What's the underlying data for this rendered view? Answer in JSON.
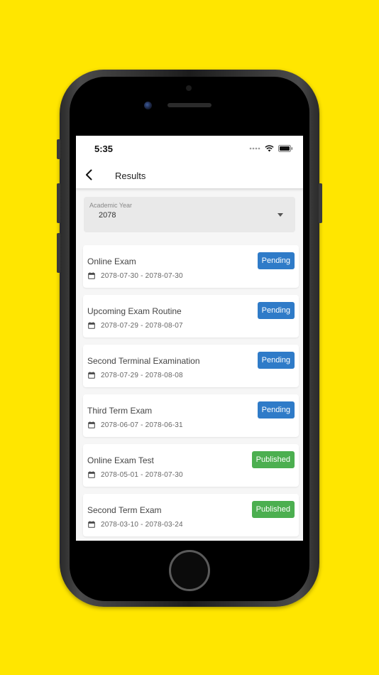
{
  "status_bar": {
    "time": "5:35"
  },
  "header": {
    "title": "Results"
  },
  "academic_year": {
    "label": "Academic Year",
    "value": "2078"
  },
  "colors": {
    "background": "#FFE600",
    "pending": "#2F7BC8",
    "published": "#4CAF50"
  },
  "exams": [
    {
      "title": "Online Exam",
      "start": "2078-07-30",
      "end": "2078-07-30",
      "status": "Pending"
    },
    {
      "title": "Upcoming Exam Routine",
      "start": "2078-07-29",
      "end": "2078-08-07",
      "status": "Pending"
    },
    {
      "title": "Second Terminal Examination",
      "start": "2078-07-29",
      "end": "2078-08-08",
      "status": "Pending"
    },
    {
      "title": "Third Term Exam",
      "start": "2078-06-07",
      "end": "2078-06-31",
      "status": "Pending"
    },
    {
      "title": "Online Exam Test",
      "start": "2078-05-01",
      "end": "2078-07-30",
      "status": "Published"
    },
    {
      "title": "Second Term Exam",
      "start": "2078-03-10",
      "end": "2078-03-24",
      "status": "Published"
    }
  ]
}
